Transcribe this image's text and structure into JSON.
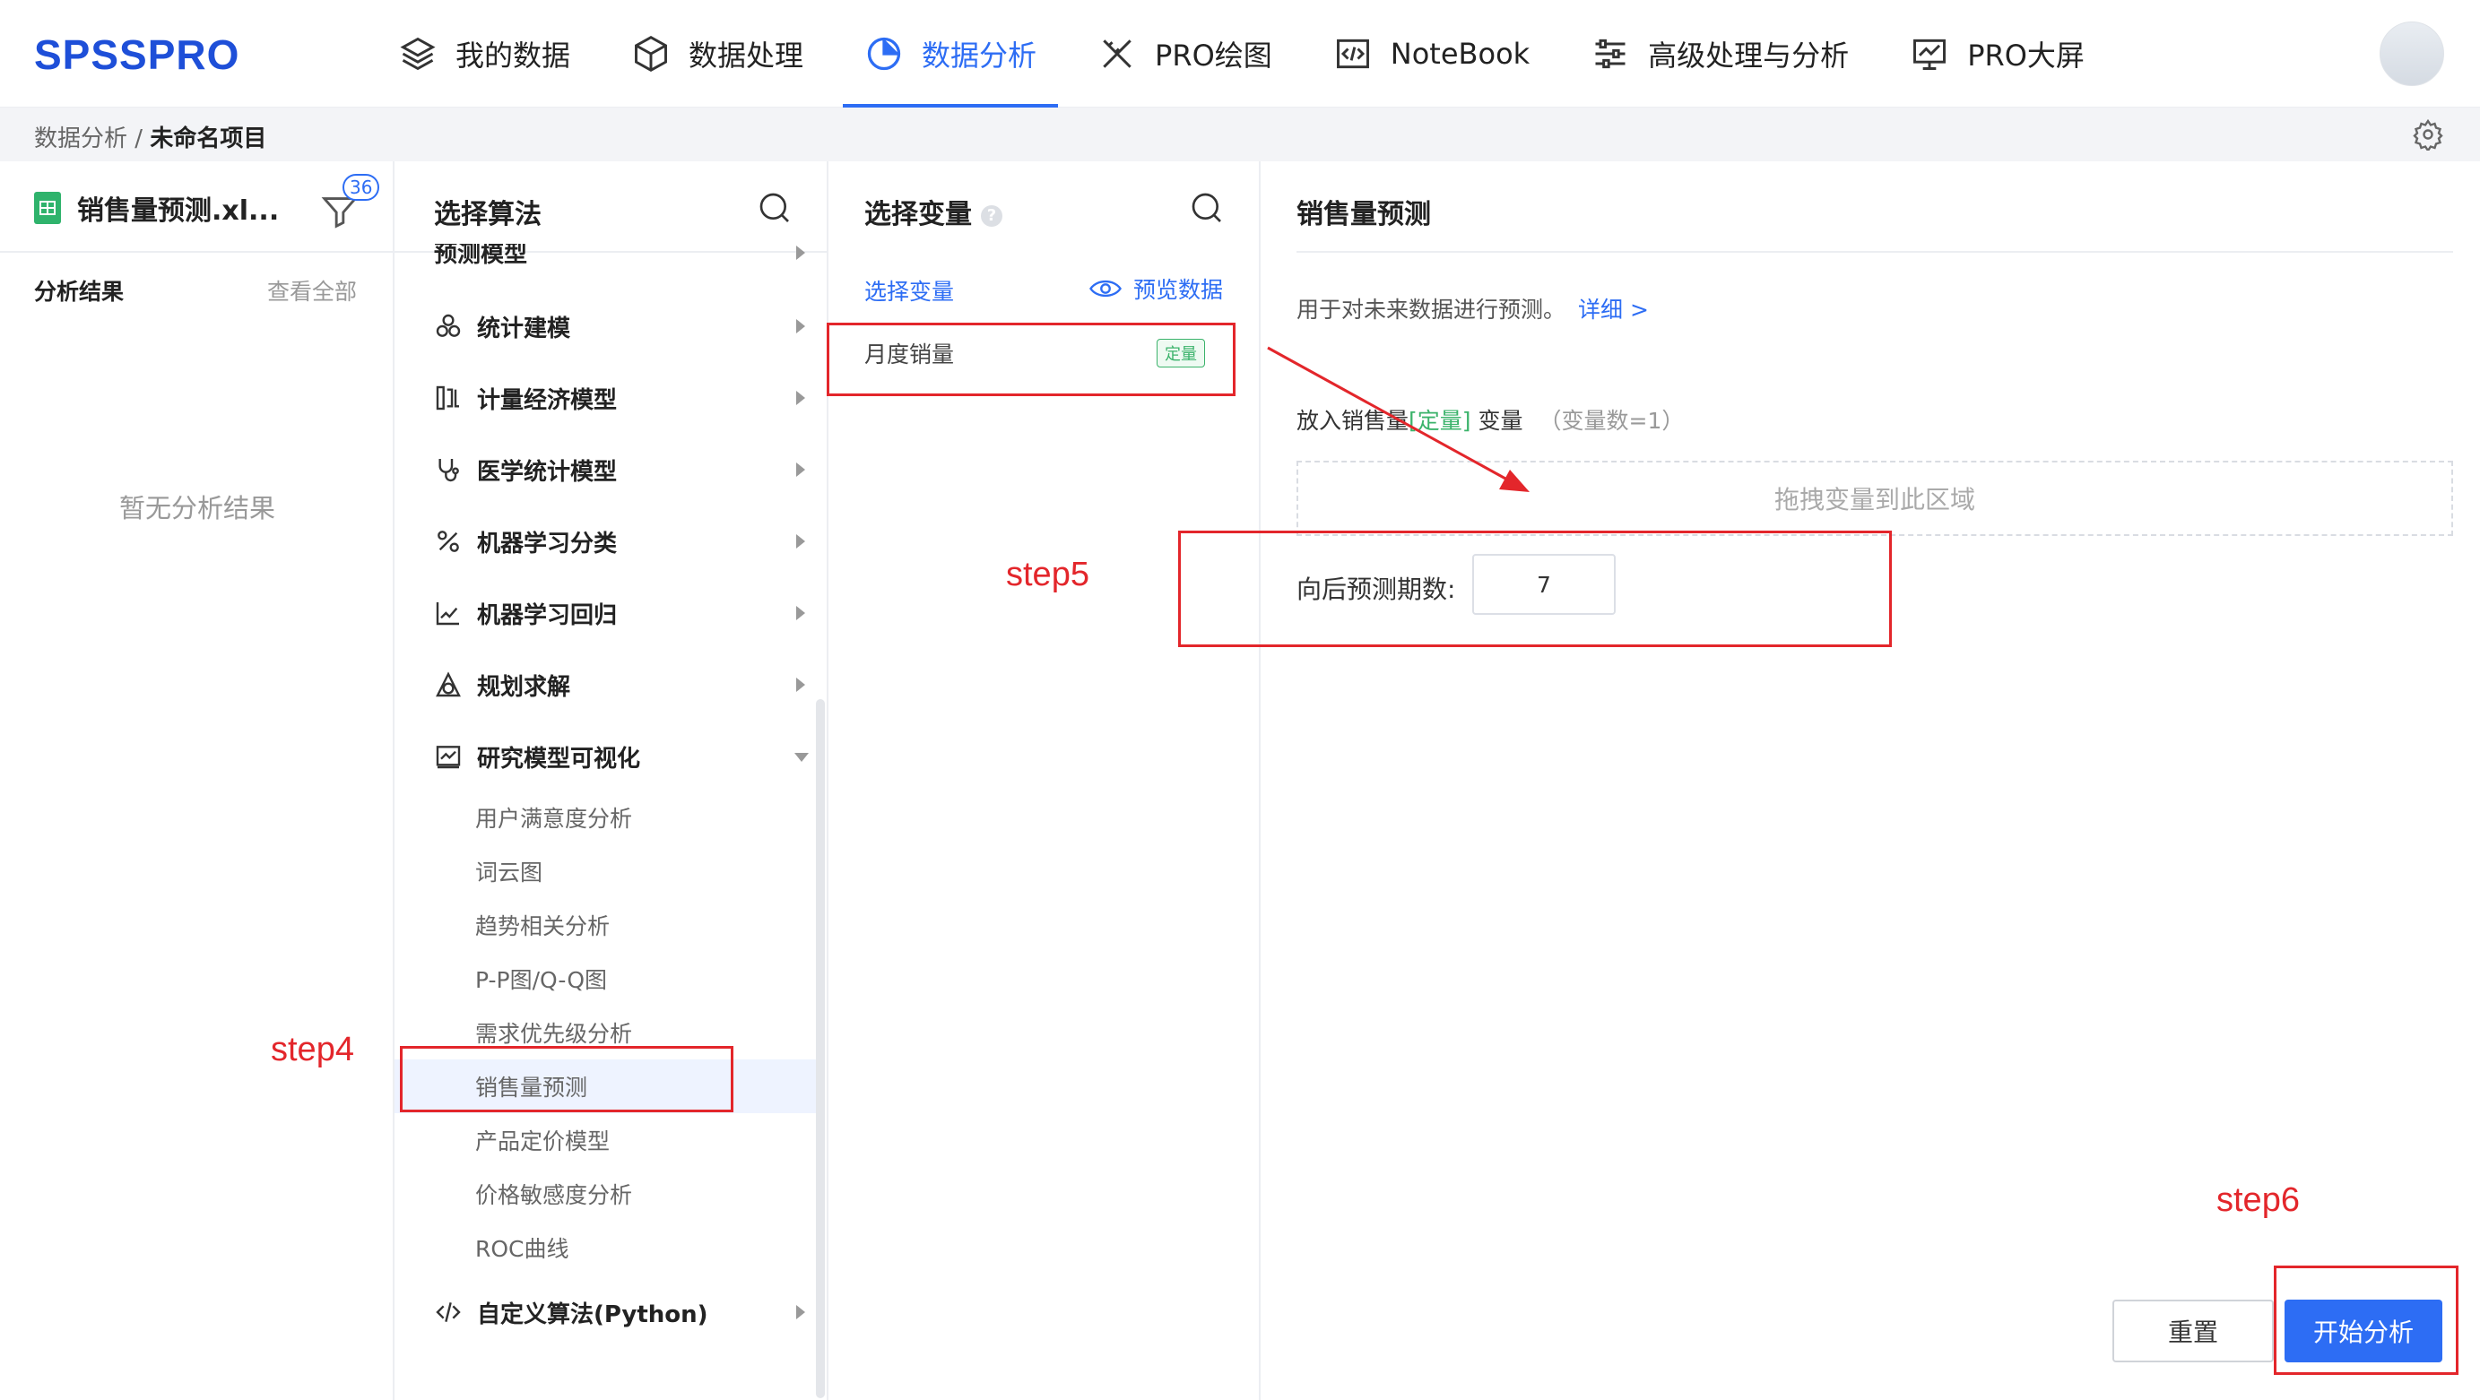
{
  "app": {
    "logo": "SPSSPRO"
  },
  "nav": [
    {
      "label": "我的数据",
      "icon": "layers-icon"
    },
    {
      "label": "数据处理",
      "icon": "cube-icon"
    },
    {
      "label": "数据分析",
      "icon": "pie-chart-icon",
      "active": true
    },
    {
      "label": "PRO绘图",
      "icon": "ruler-pencil-icon"
    },
    {
      "label": "NoteBook",
      "icon": "code-icon"
    },
    {
      "label": "高级处理与分析",
      "icon": "sliders-icon"
    },
    {
      "label": "PRO大屏",
      "icon": "monitor-chart-icon"
    }
  ],
  "breadcrumb": {
    "parent": "数据分析",
    "separator": "/",
    "current": "未命名项目"
  },
  "file_panel": {
    "file_name": "销售量预测.xl...",
    "filter_count": "36",
    "results_title": "分析结果",
    "view_all": "查看全部",
    "empty_text": "暂无分析结果"
  },
  "algo_panel": {
    "title": "选择算法",
    "partial_item": "预测模型",
    "categories": [
      {
        "label": "统计建模",
        "icon": "stats-icon"
      },
      {
        "label": "计量经济模型",
        "icon": "econ-icon"
      },
      {
        "label": "医学统计模型",
        "icon": "stethoscope-icon"
      },
      {
        "label": "机器学习分类",
        "icon": "percent-icon"
      },
      {
        "label": "机器学习回归",
        "icon": "regression-icon"
      },
      {
        "label": "规划求解",
        "icon": "planning-icon"
      },
      {
        "label": "研究模型可视化",
        "icon": "chart-window-icon"
      }
    ],
    "sub_items": [
      "用户满意度分析",
      "词云图",
      "趋势相关分析",
      "P-P图/Q-Q图",
      "需求优先级分析",
      "销售量预测",
      "产品定价模型",
      "价格敏感度分析",
      "ROC曲线"
    ],
    "custom": {
      "label": "自定义算法(Python)",
      "icon": "code-icon"
    }
  },
  "var_panel": {
    "title": "选择变量",
    "tab": "选择变量",
    "preview": "预览数据",
    "variables": [
      {
        "name": "月度销量",
        "tag": "定量"
      }
    ]
  },
  "config_panel": {
    "title": "销售量预测",
    "description": "用于对未来数据进行预测。",
    "detail_link": "详细 >",
    "put_prefix": "放入销售量",
    "put_type": "[定量]",
    "put_suffix": "变量",
    "put_count": "（变量数=1）",
    "dropzone": "拖拽变量到此区域",
    "periods_label": "向后预测期数:",
    "periods_value": "7",
    "reset": "重置",
    "start": "开始分析"
  },
  "annotations": {
    "step4": "step4",
    "step5": "step5",
    "step6": "step6"
  },
  "colors": {
    "accent": "#2d6df4",
    "annotation": "#e3262b",
    "quant_tag": "#3bb36b"
  }
}
